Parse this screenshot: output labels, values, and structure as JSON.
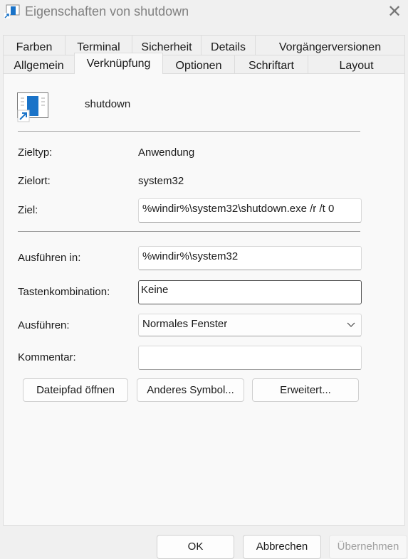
{
  "window": {
    "title": "Eigenschaften von shutdown",
    "icon": "shortcut-app-icon"
  },
  "tabs_row1": [
    "Farben",
    "Terminal",
    "Sicherheit",
    "Details",
    "Vorgängerversionen"
  ],
  "tabs_row2": [
    "Allgemein",
    "Verknüpfung",
    "Optionen",
    "Schriftart",
    "Layout"
  ],
  "selected_tab": "Verknüpfung",
  "shortcut": {
    "name": "shutdown",
    "zieltyp_label": "Zieltyp:",
    "zieltyp": "Anwendung",
    "zielort_label": "Zielort:",
    "zielort": "system32",
    "ziel_label": "Ziel:",
    "ziel": "%windir%\\system32\\shutdown.exe /r /t 0",
    "ausfuehren_in_label": "Ausführen in:",
    "ausfuehren_in": "%windir%\\system32",
    "tasten_label": "Tastenkombination:",
    "tasten": "Keine",
    "ausfuehren_label": "Ausführen:",
    "ausfuehren": "Normales Fenster",
    "kommentar_label": "Kommentar:",
    "kommentar": ""
  },
  "buttons": {
    "open_path": "Dateipfad öffnen",
    "change_icon": "Anderes Symbol...",
    "advanced": "Erweitert...",
    "ok": "OK",
    "cancel": "Abbrechen",
    "apply": "Übernehmen"
  }
}
